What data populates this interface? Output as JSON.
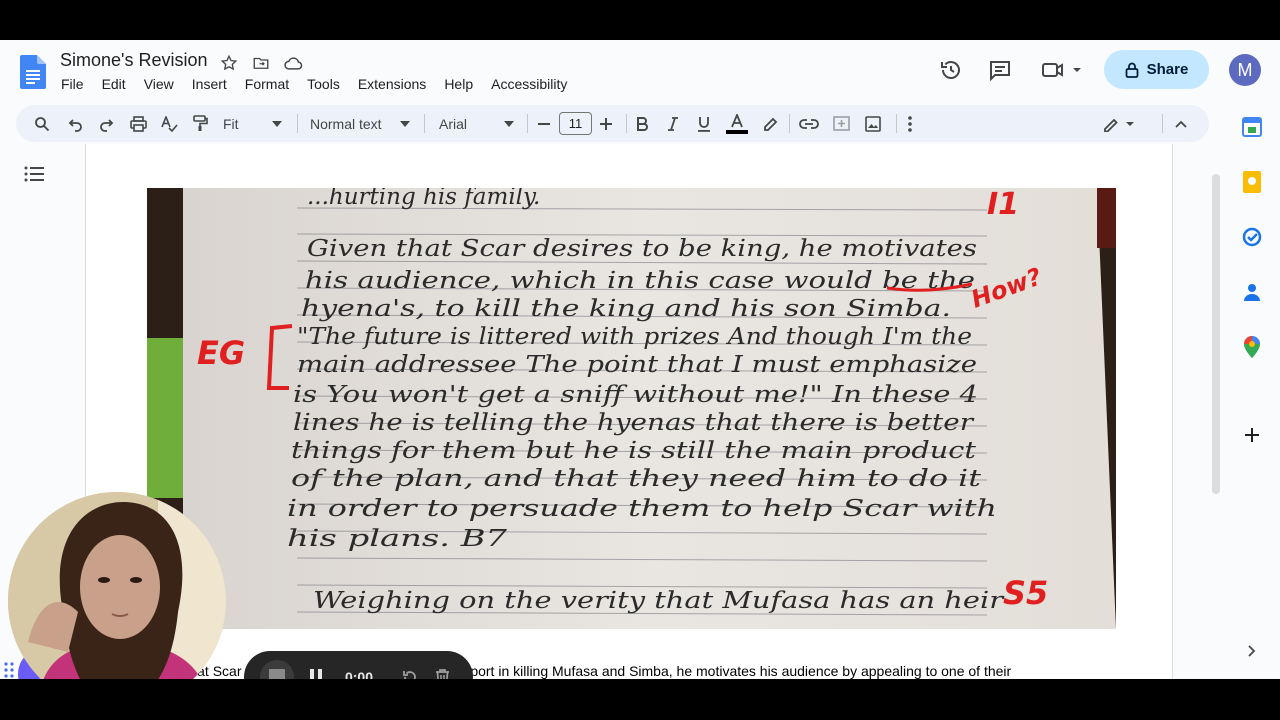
{
  "document": {
    "title": "Simone's Revision",
    "body_text": "Given that Scar desires to be king and he needs support in killing Mufasa and Simba, he motivates his audience by appealing to one of their"
  },
  "menu": [
    "File",
    "Edit",
    "View",
    "Insert",
    "Format",
    "Tools",
    "Extensions",
    "Help",
    "Accessibility"
  ],
  "toolbar": {
    "zoom": "Fit",
    "style": "Normal text",
    "font": "Arial",
    "font_size": "11"
  },
  "share": {
    "label": "Share"
  },
  "user": {
    "initial": "M",
    "color": "#5c6bc0"
  },
  "recorder": {
    "time": "0:00"
  },
  "photo": {
    "handwriting_lines": [
      "...hurting his family.",
      "Given that Scar desires to be king, he motivates",
      "his audience, which in this case would be the",
      "hyena's, to kill the king and his son Simba.",
      "\"The future is littered with prizes And though I'm the",
      "main addressee The point that I must emphasize",
      "is You won't get a sniff without me!\" In these 4",
      "lines he is telling the hyenas that there is better",
      "things for them but he is still the main product",
      "of the plan, and that they need him to do it",
      "in order to persuade them to help Scar with",
      "his plans. B7",
      "Weighing on the verity that Mufasa has an heir"
    ],
    "annotations": [
      "I1",
      "How?",
      "EG",
      "B7",
      "S5"
    ]
  },
  "colors": {
    "accent_blue": "#0b57d0",
    "share_bg": "#c2e7ff",
    "annotation_red": "#e02020"
  }
}
